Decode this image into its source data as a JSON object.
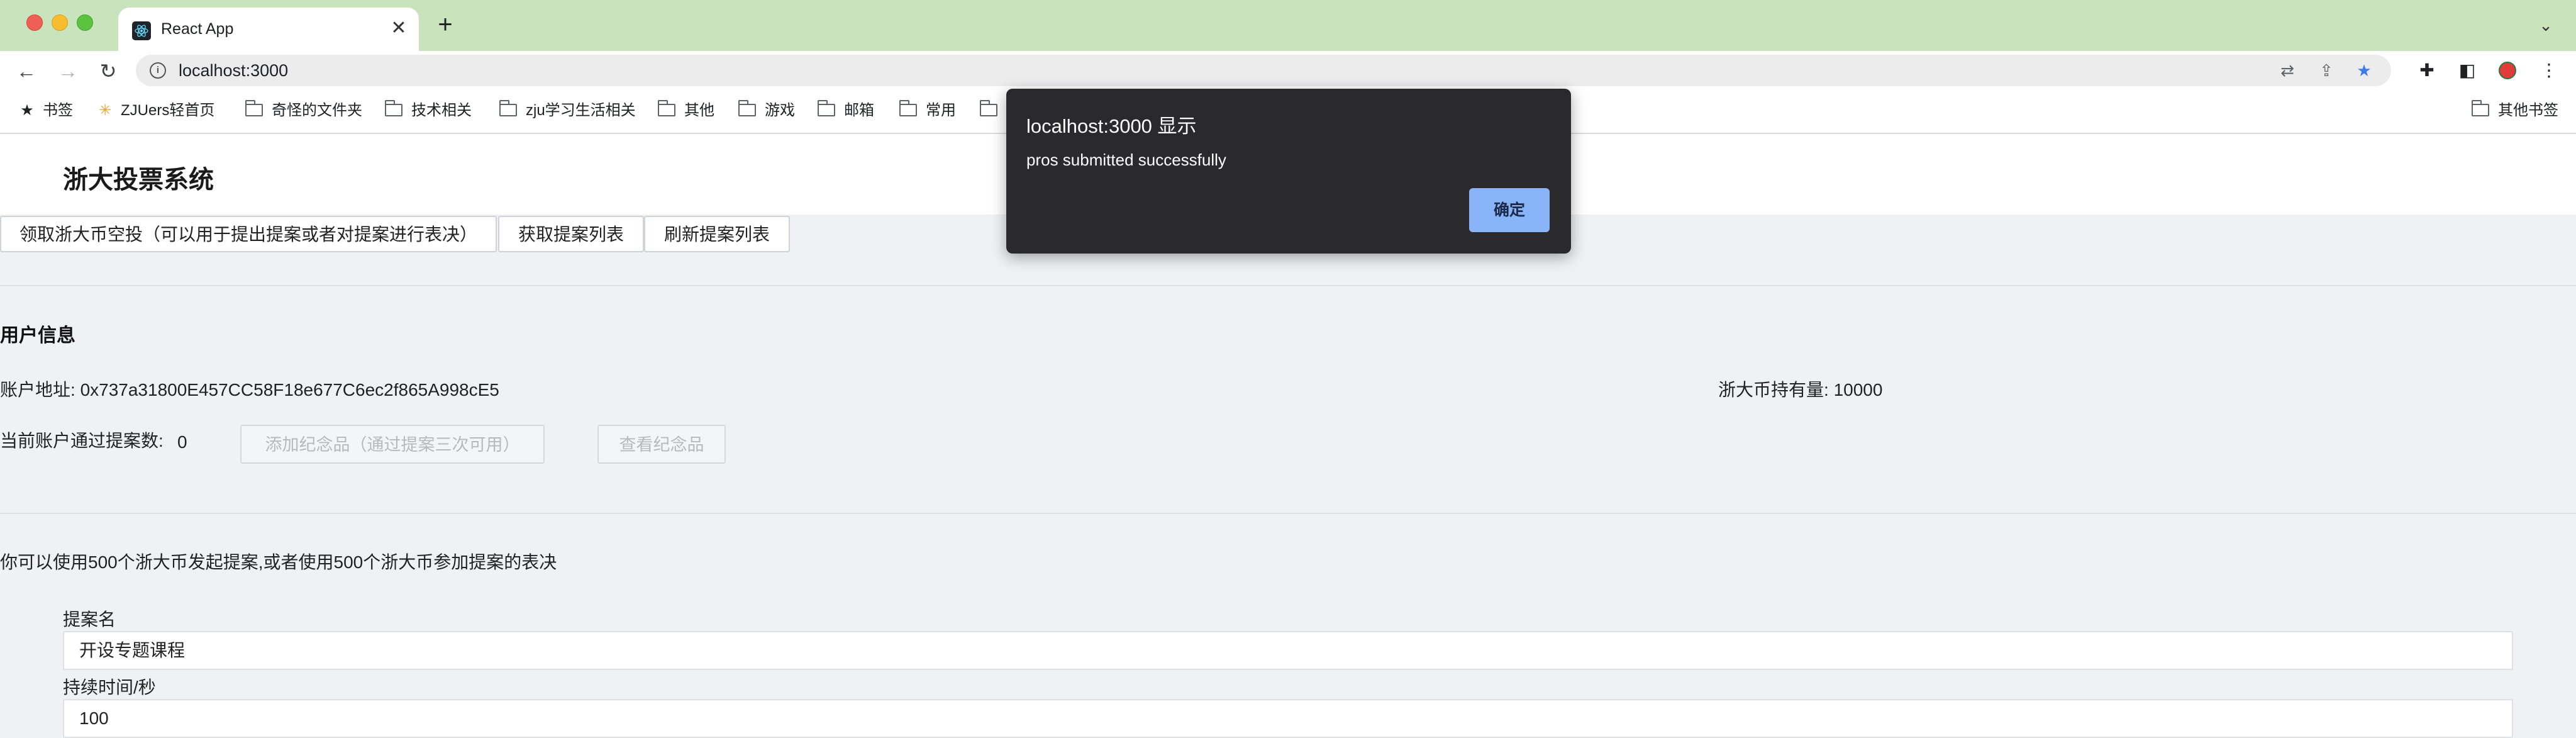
{
  "browser": {
    "tab_title": "React App",
    "url": "localhost:3000",
    "bookmarks": [
      "书签",
      "ZJUers轻首页",
      "奇怪的文件夹",
      "技术相关",
      "zju学习生活相关",
      "其他",
      "游戏",
      "邮箱",
      "常用"
    ],
    "other_bookmarks": "其他书签"
  },
  "app": {
    "title": "浙大投票系统",
    "buttons": {
      "airdrop": "领取浙大币空投（可以用于提出提案或者对提案进行表决）",
      "get_list": "获取提案列表",
      "refresh_list": "刷新提案列表"
    },
    "user_info": {
      "section_title": "用户信息",
      "account_label": "账户地址:",
      "account_value": "0x737a31800E457CC58F18e677C6ec2f865A998cE5",
      "balance_label": "浙大币持有量:",
      "balance_value": "10000",
      "passed_label": "当前账户通过提案数:",
      "passed_value": "0",
      "add_souvenir": "添加纪念品（通过提案三次可用）",
      "view_souvenir": "查看纪念品"
    },
    "proposal_hint": "你可以使用500个浙大币发起提案,或者使用500个浙大币参加提案的表决",
    "form": {
      "name_label": "提案名",
      "name_value": "开设专题课程",
      "duration_label": "持续时间/秒",
      "duration_value": "100"
    }
  },
  "alert": {
    "title": "localhost:3000 显示",
    "message": "pros submitted successfully",
    "ok": "确定"
  }
}
